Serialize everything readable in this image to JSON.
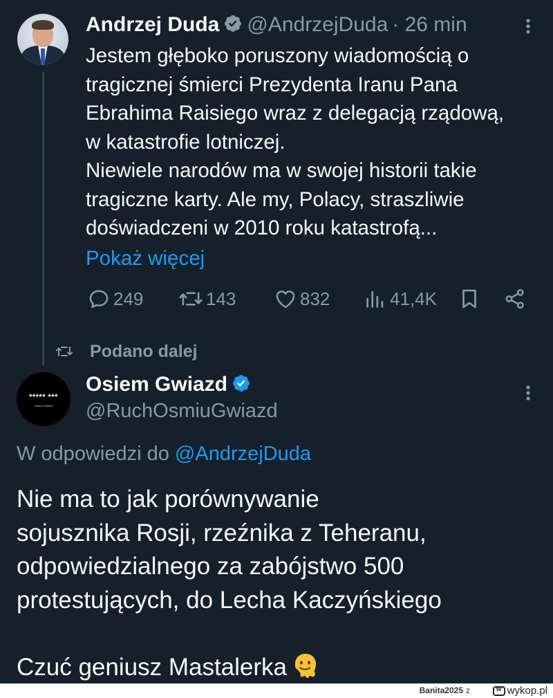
{
  "tweet": {
    "author_name": "Andrzej Duda",
    "author_handle": "@AndrzejDuda",
    "time": "· 26 min",
    "text": "Jestem głęboko poruszony wiadomością o\ntragicznej śmierci Prezydenta Iranu Pana\nEbrahima Raisiego wraz z delegacją rządową,\nw katastrofie lotniczej.\nNiewiele narodów ma w swojej historii takie\ntragiczne karty. Ale my, Polacy, straszliwie\ndoświadczeni w 2010 roku katastrofą...",
    "show_more": "Pokaż więcej",
    "stats": {
      "replies": "249",
      "retweets": "143",
      "likes": "832",
      "views": "41,4K"
    }
  },
  "retweet_label": "Podano dalej",
  "reply": {
    "author_name": "Osiem Gwiazd",
    "author_handle": "@RuchOsmiuGwiazd",
    "avatar_text": "***** ***",
    "avatar_subtext": "Osiem Gwiazd",
    "reply_to_prefix": "W odpowiedzi do",
    "reply_to_handle": "@AndrzejDuda",
    "text": "Nie ma to jak porównywanie\nsojusznika Rosji, rzeźnika z Teheranu,\nodpowiedzialnego za zabójstwo 500\nprotestujących, do Lecha Kaczyńskiego\n\nCzuć geniusz Mastalerka",
    "emoji": "melting-face-icon"
  },
  "footer": {
    "user": "Banita2025",
    "connector": "z",
    "site": "wykop.pl"
  },
  "colors": {
    "background": "#15202b",
    "text": "#f7f9f9",
    "secondary": "#8b98a5",
    "accent": "#1d9bf0"
  }
}
